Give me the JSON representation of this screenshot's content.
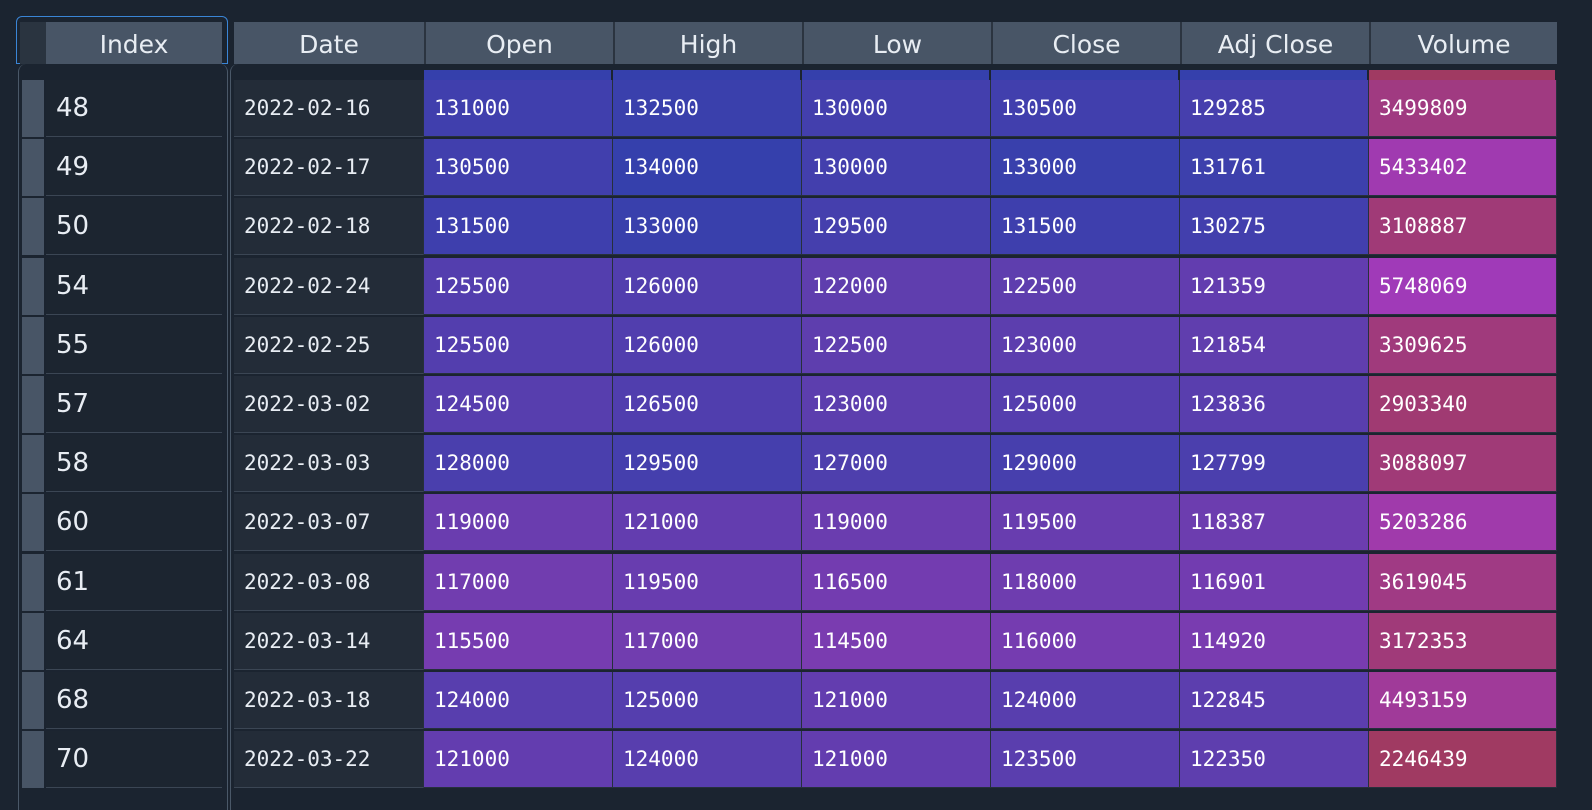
{
  "index_header": "Index",
  "columns": [
    "Date",
    "Open",
    "High",
    "Low",
    "Close",
    "Adj Close",
    "Volume"
  ],
  "rows": [
    {
      "index": "48",
      "date": "2022-02-16",
      "open": "131000",
      "high": "132500",
      "low": "130000",
      "close": "130500",
      "adj_close": "129285",
      "volume": "3499809"
    },
    {
      "index": "49",
      "date": "2022-02-17",
      "open": "130500",
      "high": "134000",
      "low": "130000",
      "close": "133000",
      "adj_close": "131761",
      "volume": "5433402"
    },
    {
      "index": "50",
      "date": "2022-02-18",
      "open": "131500",
      "high": "133000",
      "low": "129500",
      "close": "131500",
      "adj_close": "130275",
      "volume": "3108887"
    },
    {
      "index": "54",
      "date": "2022-02-24",
      "open": "125500",
      "high": "126000",
      "low": "122000",
      "close": "122500",
      "adj_close": "121359",
      "volume": "5748069"
    },
    {
      "index": "55",
      "date": "2022-02-25",
      "open": "125500",
      "high": "126000",
      "low": "122500",
      "close": "123000",
      "adj_close": "121854",
      "volume": "3309625"
    },
    {
      "index": "57",
      "date": "2022-03-02",
      "open": "124500",
      "high": "126500",
      "low": "123000",
      "close": "125000",
      "adj_close": "123836",
      "volume": "2903340"
    },
    {
      "index": "58",
      "date": "2022-03-03",
      "open": "128000",
      "high": "129500",
      "low": "127000",
      "close": "129000",
      "adj_close": "127799",
      "volume": "3088097"
    },
    {
      "index": "60",
      "date": "2022-03-07",
      "open": "119000",
      "high": "121000",
      "low": "119000",
      "close": "119500",
      "adj_close": "118387",
      "volume": "5203286"
    },
    {
      "index": "61",
      "date": "2022-03-08",
      "open": "117000",
      "high": "119500",
      "low": "116500",
      "close": "118000",
      "adj_close": "116901",
      "volume": "3619045"
    },
    {
      "index": "64",
      "date": "2022-03-14",
      "open": "115500",
      "high": "117000",
      "low": "114500",
      "close": "116000",
      "adj_close": "114920",
      "volume": "3172353"
    },
    {
      "index": "68",
      "date": "2022-03-18",
      "open": "124000",
      "high": "125000",
      "low": "121000",
      "close": "124000",
      "adj_close": "122845",
      "volume": "4493159"
    },
    {
      "index": "70",
      "date": "2022-03-22",
      "open": "121000",
      "high": "124000",
      "low": "121000",
      "close": "123500",
      "adj_close": "122350",
      "volume": "2246439"
    }
  ],
  "colors": {
    "price_high": "#3540ac",
    "price_low": "#7a3cb0",
    "volume_low": "#a03a62",
    "volume_high": "#a03ab8",
    "header_bg": "#485566",
    "selection_border": "#3a85d6"
  }
}
